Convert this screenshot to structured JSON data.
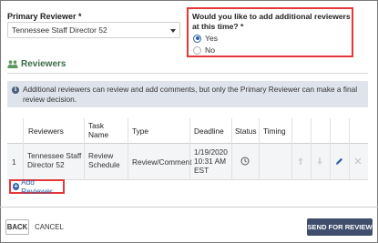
{
  "primary_reviewer": {
    "label": "Primary Reviewer *",
    "selected": "Tennessee Staff Director 52"
  },
  "additional_question": {
    "text": "Would you like to add additional reviewers at this time? *",
    "options": [
      "Yes",
      "No"
    ],
    "selected": "Yes"
  },
  "reviewers_section": {
    "title": "Reviewers",
    "info": "Additional reviewers can review and add comments, but only the Primary Reviewer can make a final review decision."
  },
  "table": {
    "headers": {
      "reviewers": "Reviewers",
      "task_name_line1": "Task",
      "task_name_line2": "Name",
      "type": "Type",
      "deadline": "Deadline",
      "status": "Status",
      "timing": "Timing"
    },
    "rows": [
      {
        "index": "1",
        "reviewer_line1": "Tennessee Staff",
        "reviewer_line2": "Director 52",
        "task_line1": "Review",
        "task_line2": "Schedule",
        "type": "Review/Comment",
        "deadline_line1": "1/19/2020",
        "deadline_line2": "10:31 AM",
        "deadline_line3": "EST"
      }
    ]
  },
  "add_reviewer_label": "Add Reviewer",
  "footer": {
    "back": "BACK",
    "cancel": "CANCEL",
    "send": "SEND FOR REVIEW"
  },
  "colors": {
    "highlight_border": "#e53838",
    "accent_blue": "#2c5fa8",
    "send_button": "#3f4e6d",
    "info_background": "#dfe4ec",
    "section_green": "#3a6b4a"
  }
}
